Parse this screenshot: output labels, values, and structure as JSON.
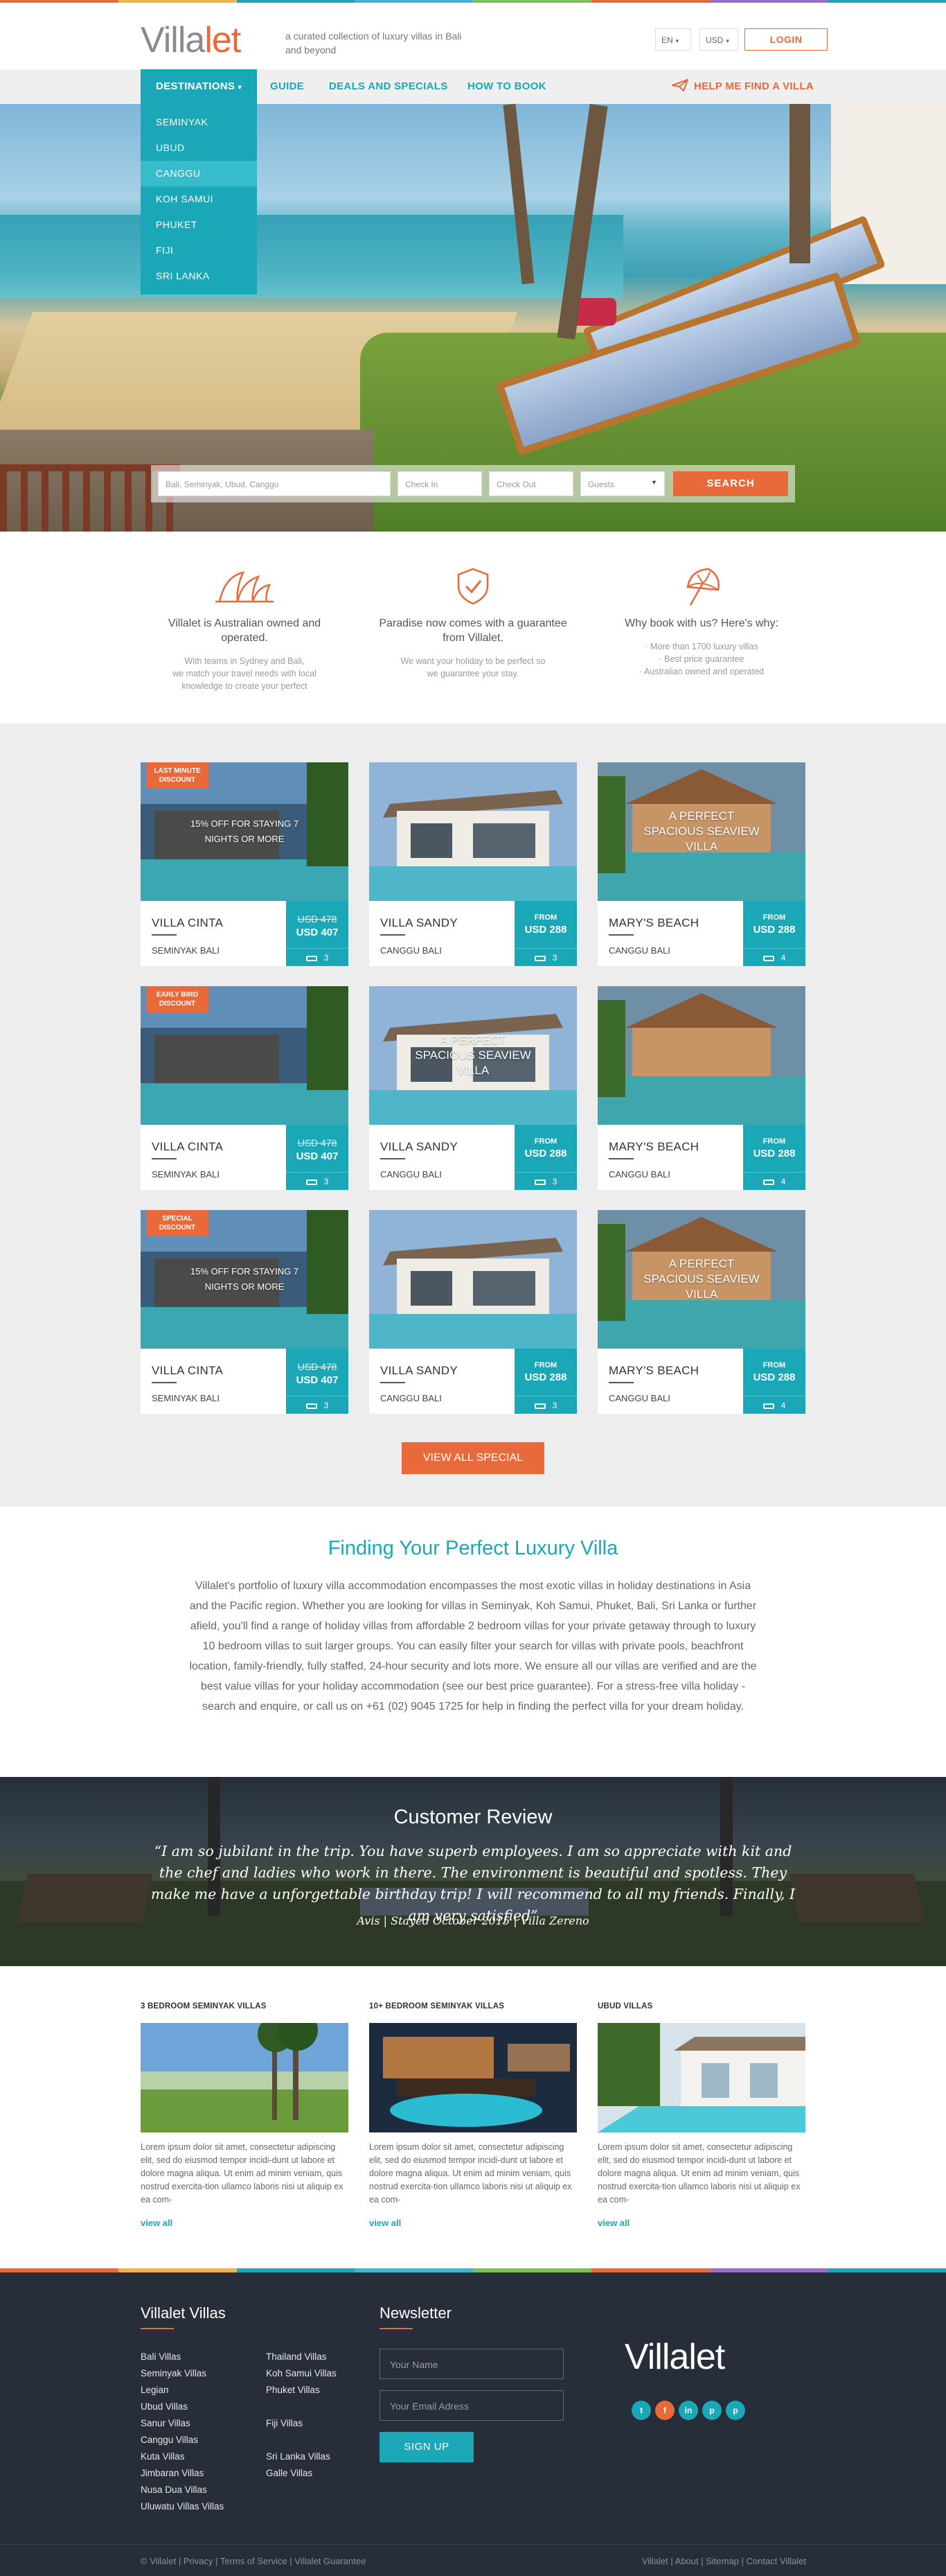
{
  "colors": {
    "accent": "#e8693a",
    "teal": "#1aa8b8",
    "dark": "#282d3a",
    "stripe": [
      "#e8693a",
      "#f7b34a",
      "#1aa8b8",
      "#3fb5d6",
      "#7dc15c",
      "#e8693a",
      "#9b6fc7",
      "#1aa8b8"
    ]
  },
  "header": {
    "logo_main": "Villa",
    "logo_accent": "let",
    "tagline": "a curated collection of luxury villas in Bali and beyond",
    "lang": "EN",
    "currency": "USD",
    "login": "LOGIN"
  },
  "nav": {
    "destinations": "DESTINATIONS",
    "items": [
      "GUIDE",
      "DEALS AND SPECIALS",
      "HOW TO BOOK"
    ],
    "help": "HELP ME FIND A VILLA",
    "help_icon": "paper-plane-icon"
  },
  "dropdown": [
    "SEMINYAK",
    "UBUD",
    "CANGGU",
    "KOH SAMUI",
    "PHUKET",
    "FIJI",
    "SRI LANKA"
  ],
  "search": {
    "location_placeholder": "Bali, Seminyak, Ubud, Canggu",
    "checkin_placeholder": "Check In",
    "checkout_placeholder": "Check Out",
    "guests_placeholder": "Guests",
    "button": "SEARCH"
  },
  "features": [
    {
      "icon": "opera-house-icon",
      "title": "Villalet is Australian owned and operated.",
      "lines": [
        "With teams in Sydney and Bali,",
        "we match your travel needs with local",
        "knowledge to create your perfect"
      ]
    },
    {
      "icon": "shield-check-icon",
      "title": "Paradise now comes with a guarantee from Villalet.",
      "lines": [
        "We want your holiday to be perfect so",
        "we guarantee your stay."
      ]
    },
    {
      "icon": "beach-umbrella-icon",
      "title": "Why book with us? Here's why:",
      "lines": [
        "· More than 1700 luxury villas",
        "· Best price guarantee",
        "· Australian owned and operated"
      ]
    }
  ],
  "listings": [
    {
      "name": "VILLA CINTA",
      "location": "SEMINYAK BALI",
      "ribbon": "LAST MINUTE DISCOUNT",
      "overlay": "15% OFF FOR STAYING 7 NIGHTS OR MORE",
      "old_price": "USD 478",
      "price": "USD 407",
      "from": "",
      "beds": "3"
    },
    {
      "name": "VILLA SANDY",
      "location": "CANGGU BALI",
      "ribbon": "",
      "overlay": "",
      "old_price": "",
      "price": "USD 288",
      "from": "FROM",
      "beds": "3"
    },
    {
      "name": "MARY'S BEACH",
      "location": "CANGGU BALI",
      "ribbon": "",
      "overlay": "A PERFECT SPACIOUS SEAVIEW VILLA",
      "old_price": "",
      "price": "USD 288",
      "from": "FROM",
      "beds": "4"
    },
    {
      "name": "VILLA CINTA",
      "location": "SEMINYAK BALI",
      "ribbon": "EARLY BIRD DISCOUNT",
      "overlay": "",
      "old_price": "USD 478",
      "price": "USD 407",
      "from": "",
      "beds": "3"
    },
    {
      "name": "VILLA SANDY",
      "location": "CANGGU BALI",
      "ribbon": "",
      "overlay": "A PERFECT SPACIOUS SEAVIEW VILLA",
      "old_price": "",
      "price": "USD 288",
      "from": "FROM",
      "beds": "3"
    },
    {
      "name": "MARY'S BEACH",
      "location": "CANGGU BALI",
      "ribbon": "",
      "overlay": "",
      "old_price": "",
      "price": "USD 288",
      "from": "FROM",
      "beds": "4"
    },
    {
      "name": "VILLA CINTA",
      "location": "SEMINYAK BALI",
      "ribbon": "SPECIAL DISCOUNT",
      "overlay": "15% OFF FOR STAYING 7 NIGHTS OR MORE",
      "old_price": "USD 478",
      "price": "USD 407",
      "from": "",
      "beds": "3"
    },
    {
      "name": "VILLA SANDY",
      "location": "CANGGU BALI",
      "ribbon": "",
      "overlay": "",
      "old_price": "",
      "price": "USD 288",
      "from": "FROM",
      "beds": "3"
    },
    {
      "name": "MARY'S BEACH",
      "location": "CANGGU BALI",
      "ribbon": "",
      "overlay": "A PERFECT SPACIOUS SEAVIEW VILLA",
      "old_price": "",
      "price": "USD 288",
      "from": "FROM",
      "beds": "4"
    }
  ],
  "view_all": "VIEW ALL SPECIAL",
  "about": {
    "title": "Finding Your Perfect Luxury Villa",
    "body": "Villalet's portfolio of luxury villa accommodation encompasses the most exotic villas in holiday destinations in Asia and the Pacific region. Whether you are looking for villas in Seminyak, Koh Samui, Phuket, Bali, Sri Lanka or further afield, you'll find a range of holiday villas from affordable 2 bedroom villas for your private getaway through to luxury 10 bedroom villas to suit larger groups. You can easily filter your search for villas with private pools, beachfront location, family-friendly, fully staffed, 24-hour security and lots more. We ensure all our villas are verified and are the best value villas for your holiday accommodation (see our best price guarantee). For a stress-free villa holiday - search and enquire, or call us on +61 (02) 9045 1725 for help in finding the perfect villa for your dream holiday."
  },
  "review": {
    "title": "Customer Review",
    "quote": "“I am so jubilant in the trip. You have superb employees. I am so appreciate with kit and the chef and ladies who work in there. The environment is beautiful and spotless. They make me have a unforgettable birthday trip! I will recommend to all my friends. Finally, I am very satisfied”",
    "byline": "Avis | Stayed October 2015 | Villa Zereno"
  },
  "posts": [
    {
      "title": "3 BEDROOM SEMINYAK VILLAS",
      "body": "Lorem ipsum dolor sit amet, consectetur adipiscing elit, sed do eiusmod tempor incidi-dunt ut labore et dolore magna aliqua. Ut enim ad minim veniam, quis nostrud exercita-tion ullamco laboris nisi ut aliquip ex ea com-",
      "link": "view all"
    },
    {
      "title": "10+ BEDROOM SEMINYAK VILLAS",
      "body": "Lorem ipsum dolor sit amet, consectetur adipiscing elit, sed do eiusmod tempor incidi-dunt ut labore et dolore magna aliqua. Ut enim ad minim veniam, quis nostrud exercita-tion ullamco laboris nisi ut aliquip ex ea com-",
      "link": "view all"
    },
    {
      "title": "UBUD VILLAS",
      "body": "Lorem ipsum dolor sit amet, consectetur adipiscing elit, sed do eiusmod tempor incidi-dunt ut labore et dolore magna aliqua. Ut enim ad minim veniam, quis nostrud exercita-tion ullamco laboris nisi ut aliquip ex ea com-",
      "link": "view all"
    }
  ],
  "footer": {
    "villas_title": "Villalet Villas",
    "col1": [
      "Bali Villas",
      "Seminyak Villas",
      "Legian",
      "Ubud Villas",
      "Sanur Villas",
      "Canggu Villas",
      "Kuta Villas",
      "Jimbaran Villas",
      "Nusa Dua Villas",
      "Uluwatu Villas Villas"
    ],
    "col2": [
      "Thailand  Villas",
      "Koh Samui Villas",
      "Phuket Villas",
      "",
      "Fiji Villas",
      "",
      "Sri Lanka Villas",
      "Galle Villas"
    ],
    "newsletter_title": "Newsletter",
    "name_placeholder": "Your Name",
    "email_placeholder": "Your Email Adress",
    "signup": "SIGN UP",
    "logo": "Villalet",
    "social": [
      "t",
      "f",
      "in",
      "p",
      "p"
    ],
    "social_icons": [
      "twitter-icon",
      "facebook-icon",
      "linkedin-icon",
      "pinterest-icon",
      "pinterest-alt-icon"
    ],
    "copyright": "© Villalet | Privacy | Terms of Service | Villalet Guarantee",
    "right_links": "Villalet | About | Sitemap | Contact Villalet"
  }
}
